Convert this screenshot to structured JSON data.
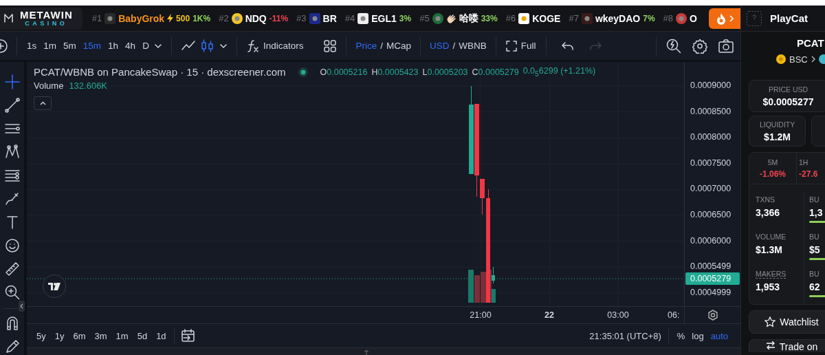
{
  "brand": {
    "word": "METAWIN",
    "sub": "CASINO"
  },
  "ticker": [
    {
      "rank": "#1",
      "name": "BabyGrok",
      "highlighted": true,
      "boost": "500",
      "change": "1K%",
      "color": "#8fd35e"
    },
    {
      "rank": "#2",
      "name": "NDQ",
      "highlighted": false,
      "change": "-11%",
      "color": "#ef4452"
    },
    {
      "rank": "#3",
      "name": "BR",
      "highlighted": false
    },
    {
      "rank": "#4",
      "name": "EGL1",
      "highlighted": false,
      "change": "3%",
      "color": "#8fd35e"
    },
    {
      "rank": "#5",
      "name": "哈喽",
      "highlighted": false,
      "change": "33%",
      "color": "#8fd35e"
    },
    {
      "rank": "#6",
      "name": "KOGE",
      "highlighted": false
    },
    {
      "rank": "#7",
      "name": "wkeyDAO",
      "highlighted": false,
      "change": "7%",
      "color": "#8fd35e"
    },
    {
      "rank": "#8",
      "name": "O",
      "highlighted": false
    }
  ],
  "toolbar": {
    "intervals": [
      {
        "label": "1s",
        "selected": false
      },
      {
        "label": "1m",
        "selected": false
      },
      {
        "label": "5m",
        "selected": false
      },
      {
        "label": "15m",
        "selected": true
      },
      {
        "label": "1h",
        "selected": false
      },
      {
        "label": "4h",
        "selected": false
      },
      {
        "label": "D",
        "selected": false
      }
    ],
    "chart_styles": [
      {
        "kind": "line",
        "selected": false
      },
      {
        "kind": "candles",
        "selected": true
      }
    ],
    "indicators": "Indicators",
    "price_toggle": [
      {
        "label": "Price",
        "selected": true
      },
      {
        "label": "MCap",
        "selected": false
      }
    ],
    "price_separator": "/",
    "currency_toggle": [
      {
        "label": "USD",
        "selected": true
      },
      {
        "label": "WBNB",
        "selected": false
      }
    ],
    "currency_separator": "/",
    "fullscreen": "Full",
    "undo": {
      "disabled": false
    },
    "redo": {
      "disabled": true
    }
  },
  "side_tools": [
    {
      "kind": "crosshair",
      "selected": true
    },
    {
      "kind": "trend-line",
      "selected": false
    },
    {
      "kind": "horizontal-lines",
      "selected": false
    },
    {
      "kind": "pattern",
      "selected": false
    },
    {
      "kind": "parallel-lines",
      "selected": false
    },
    {
      "kind": "brush",
      "selected": false
    },
    {
      "kind": "text",
      "selected": false
    },
    {
      "kind": "smiley",
      "selected": false
    },
    {
      "kind": "ruler",
      "selected": false
    },
    {
      "kind": "zoom-in",
      "selected": false
    },
    {
      "kind": "magnet",
      "selected": false
    },
    {
      "kind": "pencil",
      "selected": false
    }
  ],
  "legend": {
    "title": "PCAT/WBNB on PancakeSwap · 15 · dexscreener.com",
    "ohlc": [
      {
        "key": "O",
        "value": "0.0005216"
      },
      {
        "key": "H",
        "value": "0.0005423"
      },
      {
        "key": "L",
        "value": "0.0005203"
      },
      {
        "key": "C",
        "value": "0.0005279"
      }
    ],
    "change": "0.0$_{5}$6299 (+1.21%)",
    "volume_label": "Volume",
    "volume_value": "132.606K"
  },
  "price_axis": {
    "labels": [
      "0.0009000",
      "0.0008500",
      "0.0008000",
      "0.0007500",
      "0.0007000",
      "0.0006500",
      "0.0006000",
      "0.0005499",
      "0.0004999"
    ],
    "current": "0.0005279"
  },
  "time_axis": [
    {
      "text": "21:00",
      "major": false
    },
    {
      "text": "22",
      "major": true
    },
    {
      "text": "03:00",
      "major": false
    },
    {
      "text": "06:",
      "major": false
    }
  ],
  "ranges": [
    "5y",
    "1y",
    "6m",
    "3m",
    "1m",
    "5d",
    "1d"
  ],
  "clock": "21:35:01 (UTC+8)",
  "scale_options": [
    {
      "label": "%",
      "selected": false
    },
    {
      "label": "log",
      "selected": false
    },
    {
      "label": "auto",
      "selected": true
    }
  ],
  "pair": {
    "name": "PlayCat",
    "symbol": "PCAT",
    "chain": "BSC",
    "price": {
      "label": "PRICE USD",
      "value": "$0.0005277"
    },
    "liquidity": {
      "label": "LIQUIDITY",
      "value": "$1.2M"
    },
    "changes": [
      {
        "label": "5M",
        "value": "-1.06%",
        "color": "#ef4452"
      },
      {
        "label": "1H",
        "value": "-27.6",
        "color": "#ef4452"
      }
    ],
    "stats": [
      {
        "label": "TXNS",
        "value": "3,366",
        "underlined": false,
        "side_label": "BU",
        "side_value": "1,3"
      },
      {
        "label": "VOLUME",
        "value": "$1.3M",
        "underlined": false,
        "side_label": "BU",
        "side_value": "$5"
      },
      {
        "label": "MAKERS",
        "value": "1,953",
        "underlined": true,
        "side_label": "BU",
        "side_value": "62"
      }
    ],
    "buttons": [
      {
        "kind": "watchlist",
        "label": "Watchlist"
      },
      {
        "kind": "trade",
        "label": "Trade on"
      }
    ]
  }
}
